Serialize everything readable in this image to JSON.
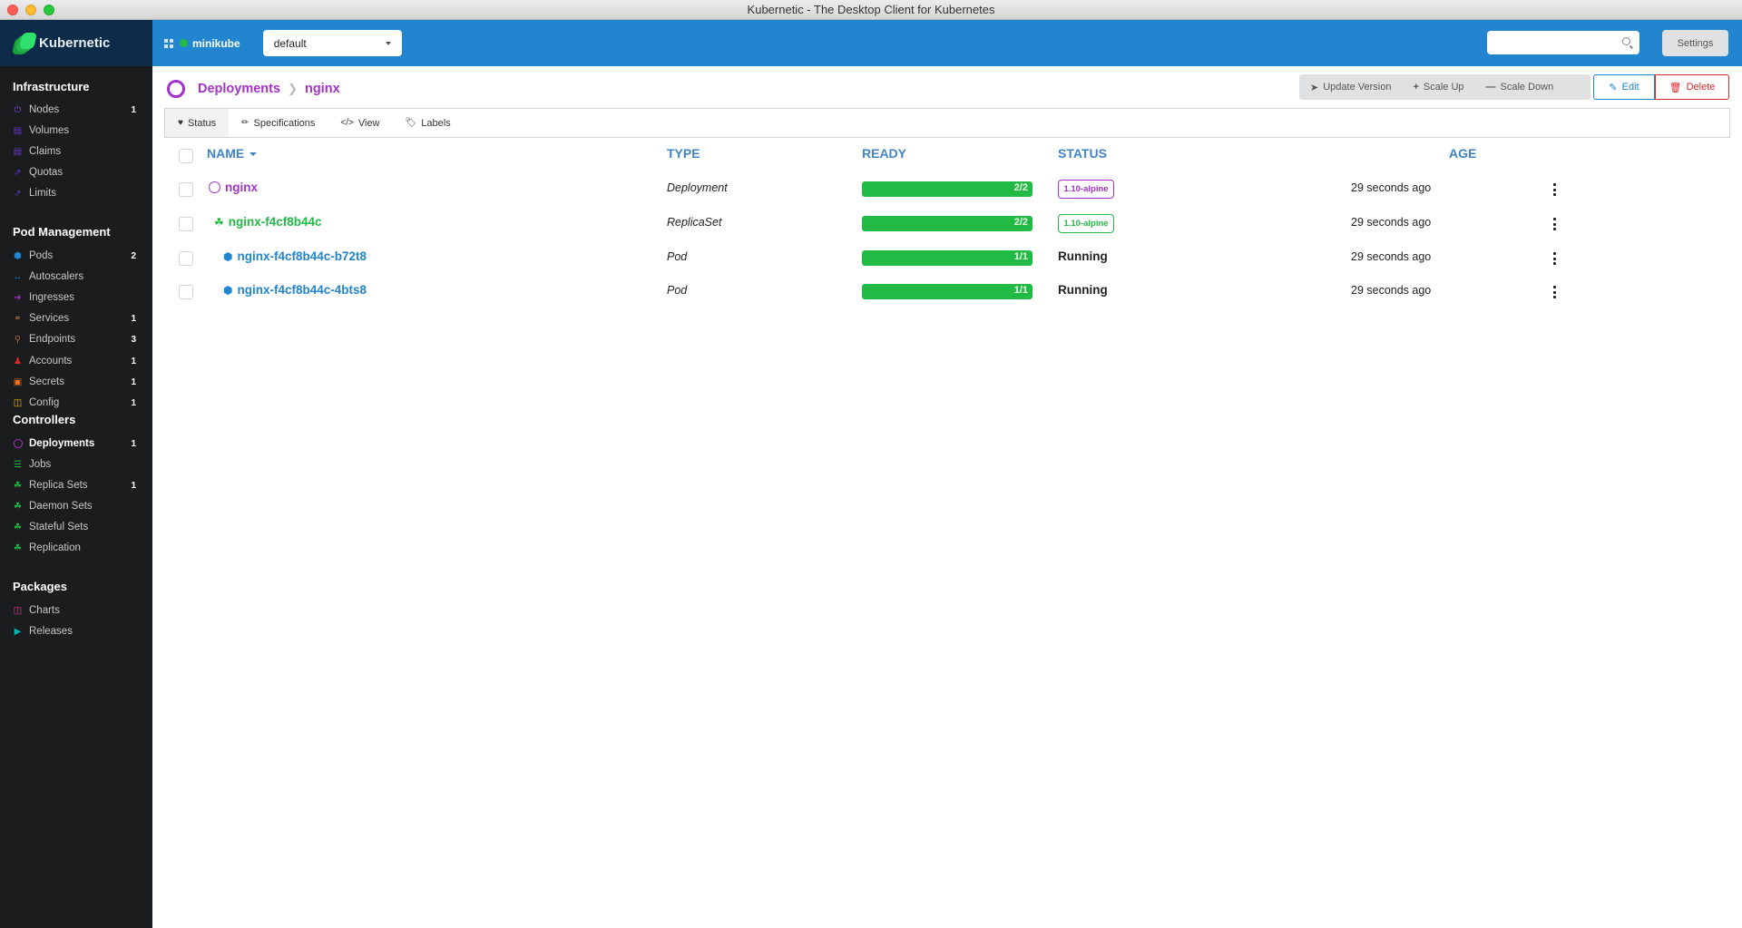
{
  "window": {
    "title": "Kubernetic - The Desktop Client for Kubernetes"
  },
  "brand": {
    "name": "Kubernetic"
  },
  "header": {
    "cluster": "minikube",
    "cluster_status_color": "#21ba45",
    "namespace": "default",
    "search_placeholder": "",
    "settings_label": "Settings"
  },
  "sidebar": {
    "sections": [
      {
        "title": "Infrastructure",
        "items": [
          {
            "label": "Nodes",
            "count": "1",
            "icon": "power-icon",
            "color": "#7b4fd6"
          },
          {
            "label": "Volumes",
            "count": "",
            "icon": "database-icon",
            "color": "#6435c9"
          },
          {
            "label": "Claims",
            "count": "",
            "icon": "database-icon",
            "color": "#6435c9"
          },
          {
            "label": "Quotas",
            "count": "",
            "icon": "external-square-icon",
            "color": "#6435c9"
          },
          {
            "label": "Limits",
            "count": "",
            "icon": "external-square-icon",
            "color": "#6435c9"
          }
        ]
      },
      {
        "title": "Pod Management",
        "items": [
          {
            "label": "Pods",
            "count": "2",
            "icon": "cube-icon",
            "color": "#2185d0"
          },
          {
            "label": "Autoscalers",
            "count": "",
            "icon": "arrows-horizontal-icon",
            "color": "#2185d0"
          },
          {
            "label": "Ingresses",
            "count": "",
            "icon": "sign-in-icon",
            "color": "#a333c8"
          },
          {
            "label": "Services",
            "count": "1",
            "icon": "chain-icon",
            "color": "#a5673f"
          },
          {
            "label": "Endpoints",
            "count": "3",
            "icon": "pin-icon",
            "color": "#a5673f"
          },
          {
            "label": "Accounts",
            "count": "1",
            "icon": "user-icon",
            "color": "#db2828"
          },
          {
            "label": "Secrets",
            "count": "1",
            "icon": "lock-icon",
            "color": "#f2711c"
          },
          {
            "label": "Config",
            "count": "1",
            "icon": "map-icon",
            "color": "#fbbd08"
          }
        ]
      },
      {
        "title": "Controllers",
        "items": [
          {
            "label": "Deployments",
            "count": "1",
            "icon": "circle-notch-icon",
            "color": "#a333c8",
            "active": true
          },
          {
            "label": "Jobs",
            "count": "",
            "icon": "server-icon",
            "color": "#21ba45"
          },
          {
            "label": "Replica Sets",
            "count": "1",
            "icon": "cubes-icon",
            "color": "#21ba45"
          },
          {
            "label": "Daemon Sets",
            "count": "",
            "icon": "cubes-icon",
            "color": "#21ba45"
          },
          {
            "label": "Stateful Sets",
            "count": "",
            "icon": "cubes-icon",
            "color": "#21ba45"
          },
          {
            "label": "Replication",
            "count": "",
            "icon": "cubes-icon",
            "color": "#21ba45"
          }
        ]
      },
      {
        "title": "Packages",
        "items": [
          {
            "label": "Charts",
            "count": "",
            "icon": "map-icon",
            "color": "#e03997"
          },
          {
            "label": "Releases",
            "count": "",
            "icon": "play-square-icon",
            "color": "#00b5ad"
          }
        ]
      }
    ]
  },
  "breadcrumb": {
    "section": "Deployments",
    "current": "nginx"
  },
  "actions": {
    "update_version": "Update Version",
    "scale_up": "Scale Up",
    "scale_down": "Scale Down",
    "edit": "Edit",
    "delete": "Delete"
  },
  "tabs": [
    {
      "label": "Status",
      "icon": "heartbeat-icon",
      "active": true
    },
    {
      "label": "Specifications",
      "icon": "pencil-icon"
    },
    {
      "label": "View",
      "icon": "code-icon"
    },
    {
      "label": "Labels",
      "icon": "tags-icon"
    }
  ],
  "table": {
    "columns": {
      "name": "NAME",
      "type": "TYPE",
      "ready": "READY",
      "status": "STATUS",
      "age": "AGE"
    },
    "rows": [
      {
        "name": "nginx",
        "type": "Deployment",
        "ready": "2/2",
        "ready_fraction": 1.0,
        "status": "1.10-alpine",
        "status_kind": "badge",
        "status_color": "#a333c8",
        "age": "29 seconds ago",
        "name_color": "#a333c8",
        "icon": "circle-notch-icon"
      },
      {
        "name": "nginx-f4cf8b44c",
        "type": "ReplicaSet",
        "ready": "2/2",
        "ready_fraction": 1.0,
        "status": "1.10-alpine",
        "status_kind": "badge",
        "status_color": "#21ba45",
        "age": "29 seconds ago",
        "name_color": "#21ba45",
        "icon": "cubes-icon"
      },
      {
        "name": "nginx-f4cf8b44c-b72t8",
        "type": "Pod",
        "ready": "1/1",
        "ready_fraction": 1.0,
        "status": "Running",
        "status_kind": "text",
        "age": "29 seconds ago",
        "name_color": "#2185d0",
        "icon": "cube-icon"
      },
      {
        "name": "nginx-f4cf8b44c-4bts8",
        "type": "Pod",
        "ready": "1/1",
        "ready_fraction": 1.0,
        "status": "Running",
        "status_kind": "text",
        "age": "29 seconds ago",
        "name_color": "#2185d0",
        "icon": "cube-icon"
      }
    ]
  }
}
